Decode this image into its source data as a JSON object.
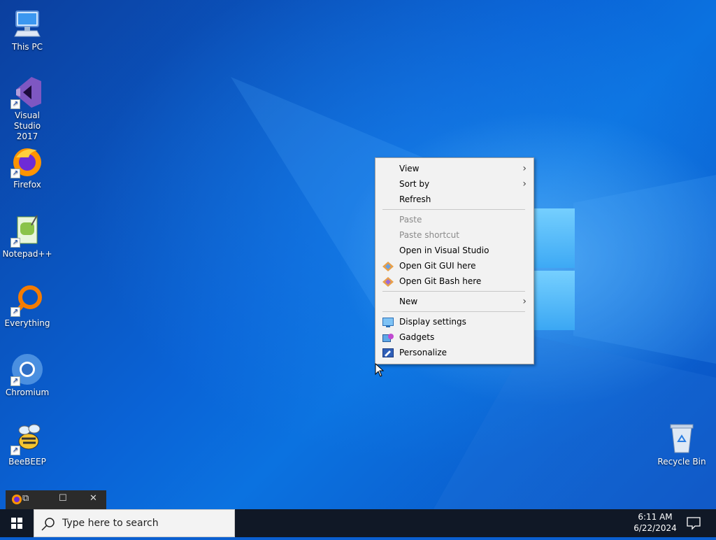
{
  "desktop": {
    "icons": [
      {
        "label": "This PC",
        "icon": "computer-icon"
      },
      {
        "label": "Visual Studio\n2017",
        "icon": "visual-studio-icon"
      },
      {
        "label": "Firefox",
        "icon": "firefox-icon"
      },
      {
        "label": "Notepad++",
        "icon": "notepad-plus-plus-icon"
      },
      {
        "label": "Everything",
        "icon": "everything-search-icon"
      },
      {
        "label": "Chromium",
        "icon": "chromium-icon"
      },
      {
        "label": "BeeBEEP",
        "icon": "beebeep-icon"
      },
      {
        "label": "Recycle Bin",
        "icon": "recycle-bin-icon"
      }
    ]
  },
  "context_menu": {
    "items": [
      {
        "label": "View",
        "submenu": true
      },
      {
        "label": "Sort by",
        "submenu": true
      },
      {
        "label": "Refresh"
      },
      {
        "label": "Paste",
        "disabled": true
      },
      {
        "label": "Paste shortcut",
        "disabled": true
      },
      {
        "label": "Open in Visual Studio"
      },
      {
        "label": "Open Git GUI here",
        "icon": "git-icon"
      },
      {
        "label": "Open Git Bash here",
        "icon": "git-icon"
      },
      {
        "label": "New",
        "submenu": true
      },
      {
        "label": "Display settings",
        "icon": "display-icon"
      },
      {
        "label": "Gadgets",
        "icon": "gadgets-icon"
      },
      {
        "label": "Personalize",
        "icon": "personalize-icon"
      }
    ],
    "arrow_glyph": "›"
  },
  "mini_window": {
    "restore_glyph": "⧉",
    "maximize_glyph": "☐",
    "close_glyph": "✕"
  },
  "taskbar": {
    "search_placeholder": "Type here to search",
    "time": "6:11 AM",
    "date": "6/22/2024"
  },
  "colors": {
    "accent": "#0a63d6",
    "taskbar": "#101826"
  }
}
